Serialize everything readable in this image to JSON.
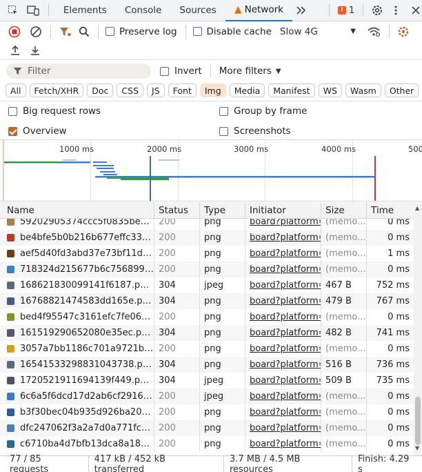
{
  "tabs": {
    "elements": "Elements",
    "console": "Console",
    "sources": "Sources",
    "network": "Network",
    "issues_count": "1"
  },
  "toolbar": {
    "preserve_log": "Preserve log",
    "disable_cache": "Disable cache",
    "throttle": "Slow 4G"
  },
  "filter": {
    "placeholder": "Filter",
    "invert": "Invert",
    "more_filters": "More filters"
  },
  "chips": [
    {
      "label": "All",
      "selected": false
    },
    {
      "label": "Fetch/XHR",
      "selected": false
    },
    {
      "label": "Doc",
      "selected": false
    },
    {
      "label": "CSS",
      "selected": false
    },
    {
      "label": "JS",
      "selected": false
    },
    {
      "label": "Font",
      "selected": false
    },
    {
      "label": "Img",
      "selected": true
    },
    {
      "label": "Media",
      "selected": false
    },
    {
      "label": "Manifest",
      "selected": false
    },
    {
      "label": "WS",
      "selected": false
    },
    {
      "label": "Wasm",
      "selected": false
    },
    {
      "label": "Other",
      "selected": false
    }
  ],
  "options": {
    "big_rows": "Big request rows",
    "group_by_frame": "Group by frame",
    "overview": "Overview",
    "screenshots": "Screenshots"
  },
  "timeline_ticks": [
    "1000 ms",
    "2000 ms",
    "3000 ms",
    "4000 ms",
    "500"
  ],
  "columns": {
    "name": "Name",
    "status": "Status",
    "type": "Type",
    "initiator": "Initiator",
    "size": "Size",
    "time": "Time"
  },
  "rows": [
    {
      "name": "59202905374ccc5f0835be5...",
      "status": "200",
      "type": "png",
      "initiator": "board?platform=",
      "size": "(memo...",
      "time": "0 ms",
      "cached": true,
      "thumb": "#b07a4a"
    },
    {
      "name": "be4bfe5b0b216b677effc33d...",
      "status": "200",
      "type": "png",
      "initiator": "board?platform=",
      "size": "(memo...",
      "time": "0 ms",
      "cached": true,
      "thumb": "#c0392b"
    },
    {
      "name": "aef5d40fd3abd37e73bf11d6...",
      "status": "200",
      "type": "png",
      "initiator": "board?platform=",
      "size": "(memo...",
      "time": "1 ms",
      "cached": true,
      "thumb": "#6b3e1f"
    },
    {
      "name": "718324d215677b6c7568993...",
      "status": "200",
      "type": "png",
      "initiator": "board?platform=",
      "size": "(memo...",
      "time": "0 ms",
      "cached": true,
      "thumb": "#3b82c4"
    },
    {
      "name": "168621830099141f6187.pn...",
      "status": "304",
      "type": "jpeg",
      "initiator": "board?platform=",
      "size": "467 B",
      "time": "752 ms",
      "cached": false,
      "thumb": "#5b6b7a"
    },
    {
      "name": "16768821474583dd165e.pn...",
      "status": "304",
      "type": "png",
      "initiator": "board?platform=",
      "size": "479 B",
      "time": "767 ms",
      "cached": false,
      "thumb": "#4a5a8a"
    },
    {
      "name": "bed4f95547c3161efc7fe067f...",
      "status": "200",
      "type": "png",
      "initiator": "board?platform=",
      "size": "(memo...",
      "time": "0 ms",
      "cached": true,
      "thumb": "#7a9a2a"
    },
    {
      "name": "161519290652080e35ec.pn...",
      "status": "304",
      "type": "png",
      "initiator": "board?platform=",
      "size": "482 B",
      "time": "741 ms",
      "cached": false,
      "thumb": "#555b66"
    },
    {
      "name": "3057a7bb1186c701a9721ba...",
      "status": "200",
      "type": "png",
      "initiator": "board?platform=",
      "size": "(memo...",
      "time": "0 ms",
      "cached": true,
      "thumb": "#d4a017"
    },
    {
      "name": "16541533298831043738.pn...",
      "status": "304",
      "type": "png",
      "initiator": "board?platform=",
      "size": "516 B",
      "time": "736 ms",
      "cached": false,
      "thumb": "#5a6a7a"
    },
    {
      "name": "1720521911694139f449.pn...",
      "status": "304",
      "type": "jpeg",
      "initiator": "board?platform=",
      "size": "509 B",
      "time": "735 ms",
      "cached": false,
      "thumb": "#4b5563"
    },
    {
      "name": "6c6a5f6dcd17d2ab6cf29164...",
      "status": "200",
      "type": "jpeg",
      "initiator": "board?platform=",
      "size": "(memo...",
      "time": "0 ms",
      "cached": true,
      "thumb": "#3a7bbf"
    },
    {
      "name": "b3f30bec04b935d926ba204...",
      "status": "200",
      "type": "png",
      "initiator": "board?platform=",
      "size": "(memo...",
      "time": "0 ms",
      "cached": true,
      "thumb": "#2c5e9e"
    },
    {
      "name": "dfc247062f3a2a7d0a771fcc...",
      "status": "200",
      "type": "png",
      "initiator": "board?platform=",
      "size": "(memo...",
      "time": "0 ms",
      "cached": true,
      "thumb": "#4d7fbf"
    },
    {
      "name": "c6710ba4d7bfb13dca8a186...",
      "status": "200",
      "type": "png",
      "initiator": "board?platform=",
      "size": "(memo...",
      "time": "0 ms",
      "cached": true,
      "thumb": "#1f6f8b"
    }
  ],
  "status_bar": {
    "requests": "77 / 85 requests",
    "transferred": "417 kB / 452 kB transferred",
    "resources": "3.7 MB / 4.5 MB resources",
    "finish": "Finish: 4.29 s"
  },
  "colors": {
    "accent": "#1a73e8",
    "record_red": "#d93025",
    "warning": "#e37400",
    "filter_active": "#b76a2a",
    "chip_selected": "#fbe3d0"
  }
}
